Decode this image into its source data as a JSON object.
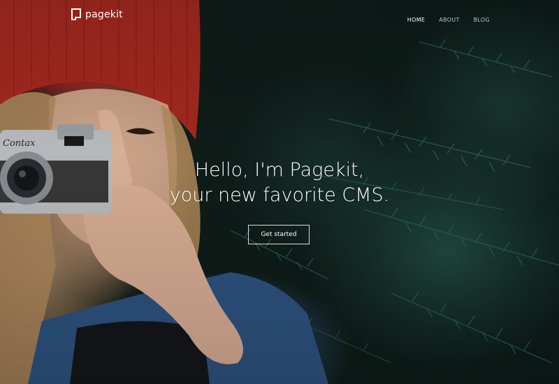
{
  "brand": {
    "name": "pagekit",
    "icon": "pagekit-logo-icon",
    "color": "#ffffff"
  },
  "nav": {
    "items": [
      {
        "label": "HOME",
        "active": true
      },
      {
        "label": "ABOUT",
        "active": false
      },
      {
        "label": "BLOG",
        "active": false
      }
    ]
  },
  "hero": {
    "line1": "Hello, I'm Pagekit,",
    "line2": "your new favorite CMS.",
    "cta_label": "Get started",
    "background": "photo-woman-with-camera-red-beanie-pine-branches"
  },
  "colors": {
    "text": "#ffffff",
    "beanie": "#a3241c",
    "foliage": "#1f4a3f"
  }
}
